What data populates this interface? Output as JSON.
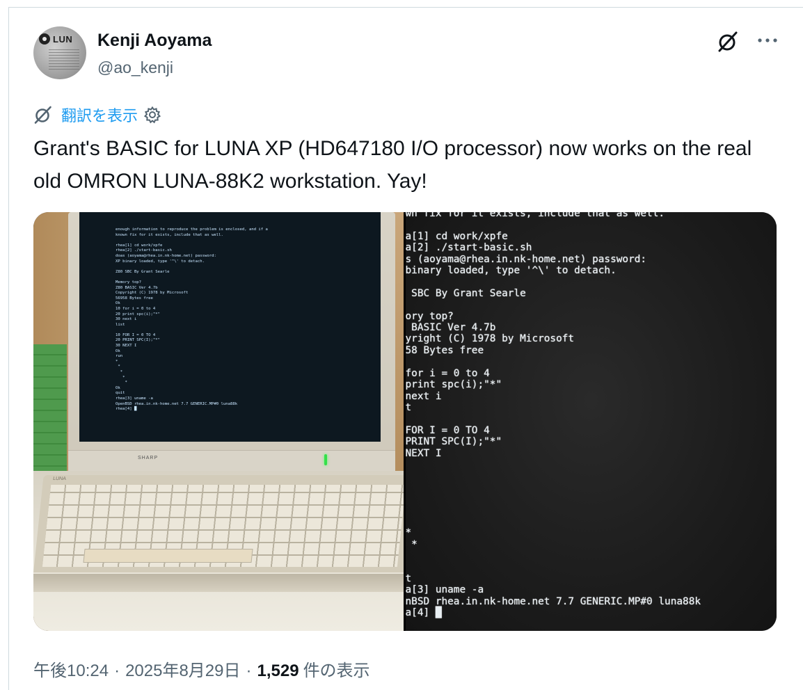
{
  "author": {
    "name": "Kenji Aoyama",
    "handle": "@ao_kenji",
    "avatar_text": "LUN"
  },
  "actions": {
    "grok_icon": "grok-icon",
    "more_icon": "more-icon"
  },
  "translate": {
    "icon": "grok-icon",
    "label": "翻訳を表示",
    "settings_icon": "gear-icon"
  },
  "post": {
    "text": "Grant's BASIC for LUNA XP (HD647180 I/O processor)  now works on the real old OMRON LUNA-88K2 workstation. Yay!"
  },
  "media": {
    "photo_left": {
      "monitor_brand": "SHARP",
      "keyboard_brand": "LUNA",
      "screen_text": "enough information to reproduce the problem is enclosed, and if a\nknown fix for it exists, include that as well.\n\nrhea[1] cd work/xpfe\nrhea[2] ./start-basic.sh\ndoas (aoyama@rhea.in.nk-home.net) password:\nXP binary loaded, type '^\\' to detach.\n\nZ80 SBC By Grant Searle\n\nMemory top?\nZ80 BASIC Ver 4.7b\nCopyright (C) 1978 by Microsoft\n56958 Bytes free\nOk\n10 for i = 0 to 4\n20 print spc(i);\"*\"\n30 next i\nlist\n\n10 FOR I = 0 TO 4\n20 PRINT SPC(I);\"*\"\n30 NEXT I\nOk\nrun\n*\n *\n  *\n   *\n    *\nOk\nquit\nrhea[3] uname -a\nOpenBSD rhea.in.nk-home.net 7.7 GENERIC.MP#0 luna88k\nrhea[4] █"
    },
    "photo_right": {
      "screen_text": "wn fix for it exists, include that as well.\n\na[1] cd work/xpfe\na[2] ./start-basic.sh\ns (aoyama@rhea.in.nk-home.net) password:\nbinary loaded, type '^\\' to detach.\n\n SBC By Grant Searle\n\nory top?\n BASIC Ver 4.7b\nyright (C) 1978 by Microsoft\n58 Bytes free\n\nfor i = 0 to 4\nprint spc(i);\"*\"\nnext i\nt\n\nFOR I = 0 TO 4\nPRINT SPC(I);\"*\"\nNEXT I\n\n\n\n\n\n\n*\n *\n\n\nt\na[3] uname -a\nnBSD rhea.in.nk-home.net 7.7 GENERIC.MP#0 luna88k\na[4] █"
    }
  },
  "meta": {
    "time": "午後10:24",
    "separator": "·",
    "date": "2025年8月29日",
    "views_count": "1,529",
    "views_label": "件の表示"
  },
  "colors": {
    "text": "#0f1419",
    "secondary": "#536471",
    "link": "#1d9bf0",
    "border": "#cfd9de"
  }
}
